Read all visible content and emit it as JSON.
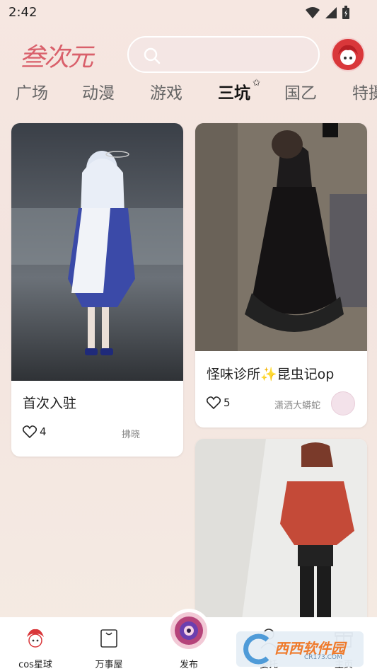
{
  "status_bar": {
    "time": "2:42"
  },
  "header": {
    "logo_text": "叁次元",
    "search": {
      "placeholder": ""
    }
  },
  "tabs": [
    {
      "label": "广场"
    },
    {
      "label": "动漫"
    },
    {
      "label": "游戏"
    },
    {
      "label": "三坑",
      "active": true
    },
    {
      "label": "国乙"
    },
    {
      "label": "特摄"
    }
  ],
  "feed": [
    {
      "title": "首次入驻",
      "likes": "4",
      "author": "拂晓"
    },
    {
      "title": "怪味诊所✨昆虫记op",
      "likes": "5",
      "author": "潇洒大蟒蛇"
    },
    {
      "title": "",
      "likes": "",
      "author": ""
    }
  ],
  "bottom_nav": [
    {
      "label": "cos星球",
      "icon": "planet-mascot-icon"
    },
    {
      "label": "万事屋",
      "icon": "shopping-bag-icon"
    },
    {
      "label": "发布",
      "icon": "publish-camera-icon"
    },
    {
      "label": "委托",
      "icon": "commission-icon"
    },
    {
      "label": "主页",
      "icon": "gift-icon"
    }
  ],
  "watermark": {
    "text": "西西软件园",
    "sub": "CR173.COM"
  },
  "colors": {
    "accent": "#d9373a",
    "logo": "#d9606b",
    "background": "#f6e7e1"
  }
}
